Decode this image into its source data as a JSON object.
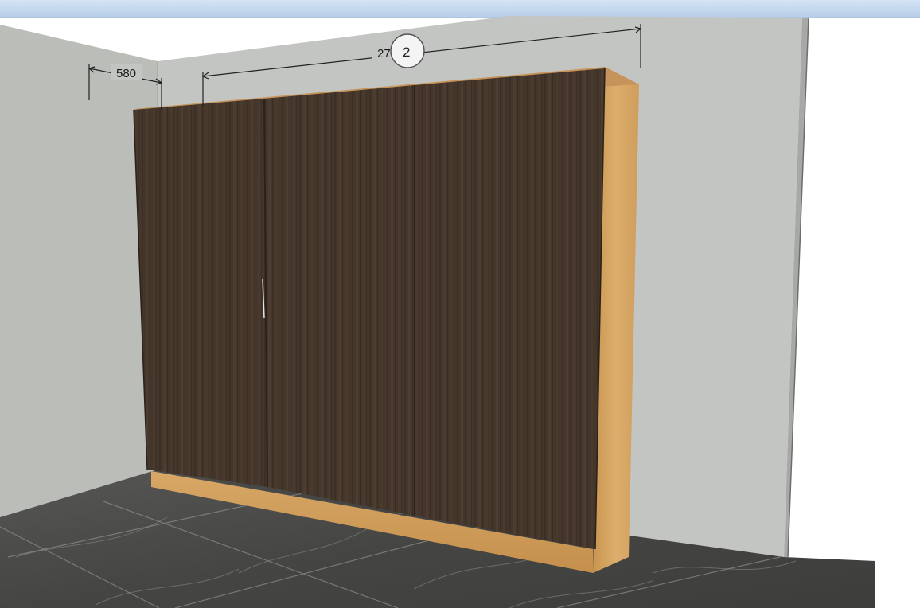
{
  "viewport": {
    "colors": {
      "top_bar": "#c4d8ef",
      "back_wall": "#c3c5c2",
      "left_wall": "#bdbfbb",
      "right_wall_face": "#f2f2f2",
      "floor": "#4a4a48",
      "door_wood": "#4a3a2e",
      "carcass_oak": "#d8a866",
      "dimension_line": "#222222"
    }
  },
  "dimensions": {
    "depth_label": "580",
    "width_label": "2700"
  },
  "orbit_gizmo": {
    "label": "2"
  },
  "wardrobe": {
    "door_count": 3
  }
}
